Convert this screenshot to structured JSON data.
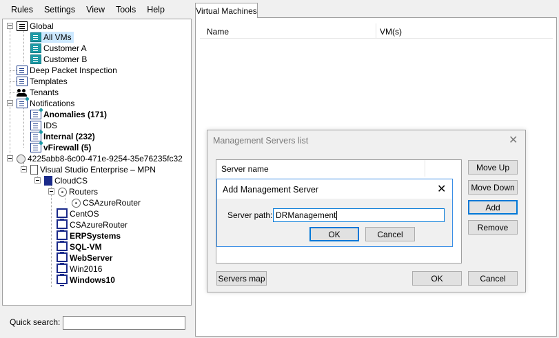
{
  "menu": [
    "Rules",
    "Settings",
    "View",
    "Tools",
    "Help"
  ],
  "tree": {
    "global": "Global",
    "all_vms": "All VMs",
    "customer_a": "Customer A",
    "customer_b": "Customer B",
    "dpi": "Deep Packet Inspection",
    "templates": "Templates",
    "tenants": "Tenants",
    "notifications": "Notifications",
    "anomalies": "Anomalies (171)",
    "ids": "IDS",
    "internal": "Internal (232)",
    "vfirewall": "vFirewall (5)",
    "host_id": "4225abb8-6c00-471e-9254-35e76235fc32",
    "subscription": "Visual Studio Enterprise – MPN",
    "cloudcs": "CloudCS",
    "routers": "Routers",
    "csazurerouter_router": "CSAzureRouter",
    "centos": "CentOS",
    "csazurerouter_vm": "CSAzureRouter",
    "erpsystems": "ERPSystems",
    "sqlvm": "SQL-VM",
    "webserver": "WebServer",
    "win2016": "Win2016",
    "windows10": "Windows10"
  },
  "quick_search": {
    "label": "Quick search:",
    "value": ""
  },
  "vm_tab": {
    "label": "Virtual Machines",
    "col_name": "Name",
    "col_vms": "VM(s)"
  },
  "msl_dialog": {
    "title": "Management Servers list",
    "list_header": "Server name",
    "move_up": "Move Up",
    "move_down": "Move Down",
    "add": "Add",
    "remove": "Remove",
    "servers_map": "Servers map",
    "ok": "OK",
    "cancel": "Cancel"
  },
  "ams_dialog": {
    "title": "Add Management Server",
    "path_label": "Server path:",
    "path_value": "DRManagement",
    "ok": "OK",
    "cancel": "Cancel"
  },
  "colors": {
    "accent": "#0078d7",
    "teal_icon": "#1e9aa5",
    "vm_icon": "#1a2a8a"
  }
}
